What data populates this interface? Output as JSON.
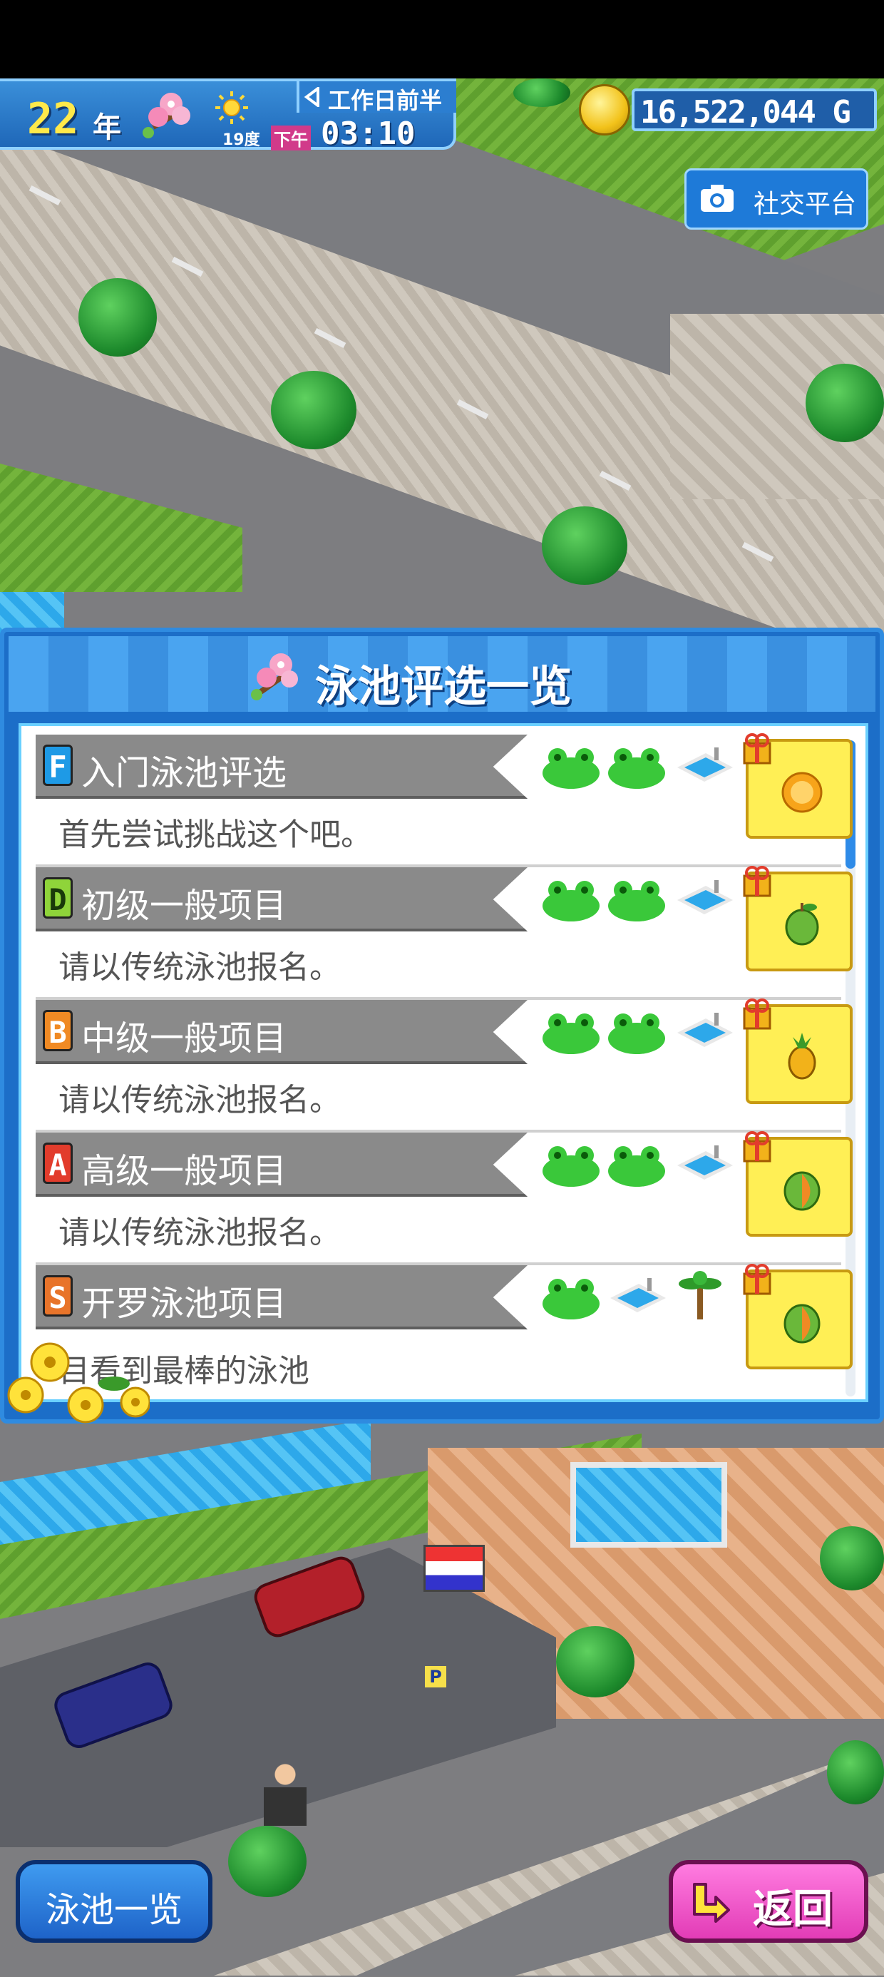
{
  "hud": {
    "year": "22",
    "year_unit": "年",
    "temperature": "19度",
    "ampm": "下午",
    "time": "03:10",
    "period": "工作日前半",
    "money": "16,522,044 G"
  },
  "social": {
    "label": "社交平台",
    "icon": "camera-icon"
  },
  "modal": {
    "title": "泳池评选一览",
    "items": [
      {
        "grade": "F",
        "grade_color": "#1e9ae6",
        "title": "入门泳池评选",
        "desc": "首先尝试挑战这个吧。",
        "frogs": 2,
        "reward": "orange"
      },
      {
        "grade": "D",
        "grade_color": "#8fd43a",
        "title": "初级一般项目",
        "desc": "请以传统泳池报名。",
        "frogs": 2,
        "reward": "green-apple"
      },
      {
        "grade": "B",
        "grade_color": "#f08a24",
        "title": "中级一般项目",
        "desc": "请以传统泳池报名。",
        "frogs": 2,
        "reward": "pineapple"
      },
      {
        "grade": "A",
        "grade_color": "#e23c2c",
        "title": "高级一般项目",
        "desc": "请以传统泳池报名。",
        "frogs": 2,
        "reward": "papaya"
      },
      {
        "grade": "S",
        "grade_color": "#e8742a",
        "title": "开罗泳池项目",
        "desc": "目看到最棒的泳池",
        "frogs": 1,
        "reward": "papaya"
      }
    ]
  },
  "buttons": {
    "pool_list": "泳池一览",
    "back": "返回"
  }
}
